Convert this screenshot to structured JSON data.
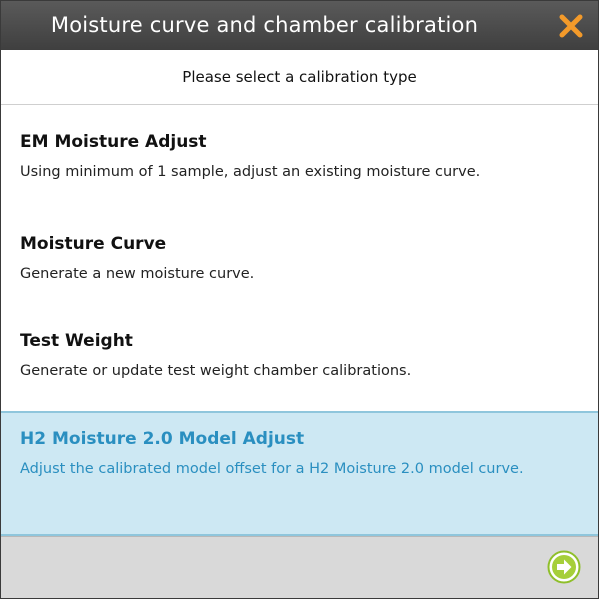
{
  "dialog": {
    "title": "Moisture curve and chamber calibration",
    "close_icon": "close-x-icon",
    "accent_color": "#f39a2a"
  },
  "subtitle": "Please select a calibration type",
  "options": [
    {
      "title": "EM Moisture Adjust",
      "description": "Using minimum of 1 sample, adjust an existing moisture curve.",
      "selected": false
    },
    {
      "title": "Moisture Curve",
      "description": "Generate a new moisture curve.",
      "selected": false
    },
    {
      "title": "Test Weight",
      "description": "Generate or update test weight chamber calibrations.",
      "selected": false
    },
    {
      "title": "H2 Moisture 2.0 Model Adjust",
      "description": "Adjust the calibrated model offset for a H2 Moisture 2.0 model curve.",
      "selected": true
    }
  ],
  "selection_color": "#cde8f3",
  "selected_text_color": "#2a8fc0",
  "footer": {
    "next_icon": "arrow-right-circle-icon",
    "next_color": "#a6cf3a"
  }
}
